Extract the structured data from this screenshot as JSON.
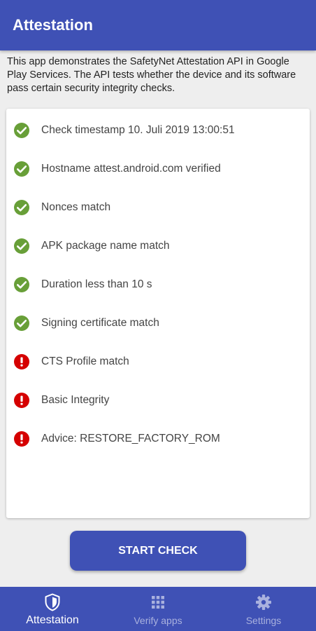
{
  "app_bar": {
    "title": "Attestation"
  },
  "intro_text": "This app demonstrates the SafetyNet Attestation API in Google Play Services. The API tests whether the device and its software pass certain security integrity checks.",
  "checks": [
    {
      "label": "Check timestamp 10. Juli 2019 13:00:51",
      "status": "pass",
      "icon": "check-circle-icon"
    },
    {
      "label": "Hostname attest.android.com verified",
      "status": "pass",
      "icon": "check-circle-icon"
    },
    {
      "label": "Nonces match",
      "status": "pass",
      "icon": "check-circle-icon"
    },
    {
      "label": "APK package name match",
      "status": "pass",
      "icon": "check-circle-icon"
    },
    {
      "label": "Duration less than 10 s",
      "status": "pass",
      "icon": "check-circle-icon"
    },
    {
      "label": "Signing certificate match",
      "status": "pass",
      "icon": "check-circle-icon"
    },
    {
      "label": "CTS Profile match",
      "status": "fail",
      "icon": "alert-circle-icon"
    },
    {
      "label": "Basic Integrity",
      "status": "fail",
      "icon": "alert-circle-icon"
    },
    {
      "label": "Advice: RESTORE_FACTORY_ROM",
      "status": "fail",
      "icon": "alert-circle-icon"
    }
  ],
  "start_button": {
    "label": "START CHECK"
  },
  "bottom_nav": {
    "items": [
      {
        "label": "Attestation",
        "icon": "shield-icon",
        "active": true
      },
      {
        "label": "Verify apps",
        "icon": "grid-icon",
        "active": false
      },
      {
        "label": "Settings",
        "icon": "gear-icon",
        "active": false
      }
    ]
  },
  "colors": {
    "primary": "#3f51b5",
    "pass": "#689f38",
    "fail": "#d50000",
    "background": "#eeeeee",
    "nav_inactive": "#a9b1de"
  }
}
